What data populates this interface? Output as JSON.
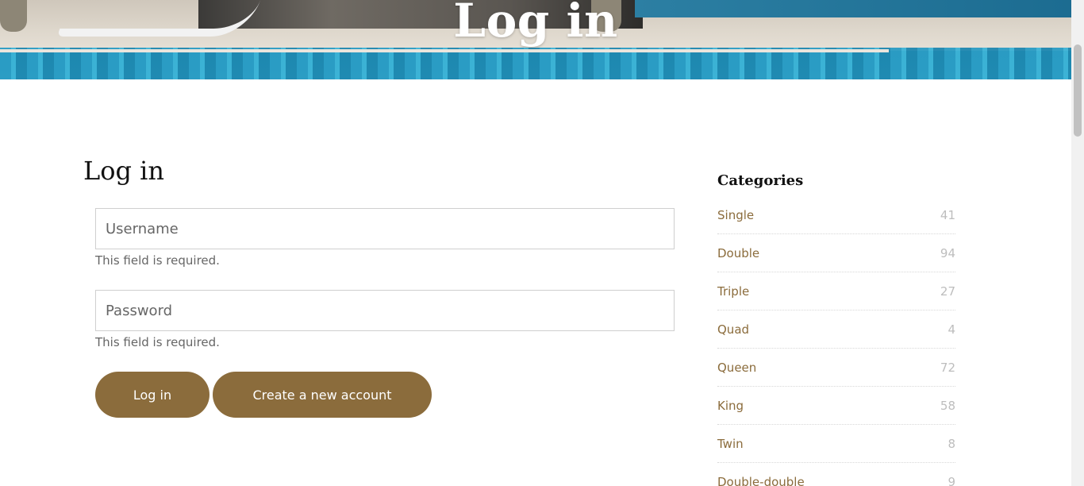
{
  "hero": {
    "title": "Log in"
  },
  "main": {
    "heading": "Log in",
    "username": {
      "placeholder": "Username",
      "hint": "This field is required."
    },
    "password": {
      "placeholder": "Password",
      "hint": "This field is required."
    },
    "login_button": "Log in",
    "create_account_button": "Create a new account"
  },
  "sidebar": {
    "title": "Categories",
    "categories": [
      {
        "name": "Single",
        "count": "41"
      },
      {
        "name": "Double",
        "count": "94"
      },
      {
        "name": "Triple",
        "count": "27"
      },
      {
        "name": "Quad",
        "count": "4"
      },
      {
        "name": "Queen",
        "count": "72"
      },
      {
        "name": "King",
        "count": "58"
      },
      {
        "name": "Twin",
        "count": "8"
      },
      {
        "name": "Double-double",
        "count": "9"
      }
    ]
  },
  "colors": {
    "accent": "#8b6c3c",
    "muted": "#bdbdbd"
  }
}
